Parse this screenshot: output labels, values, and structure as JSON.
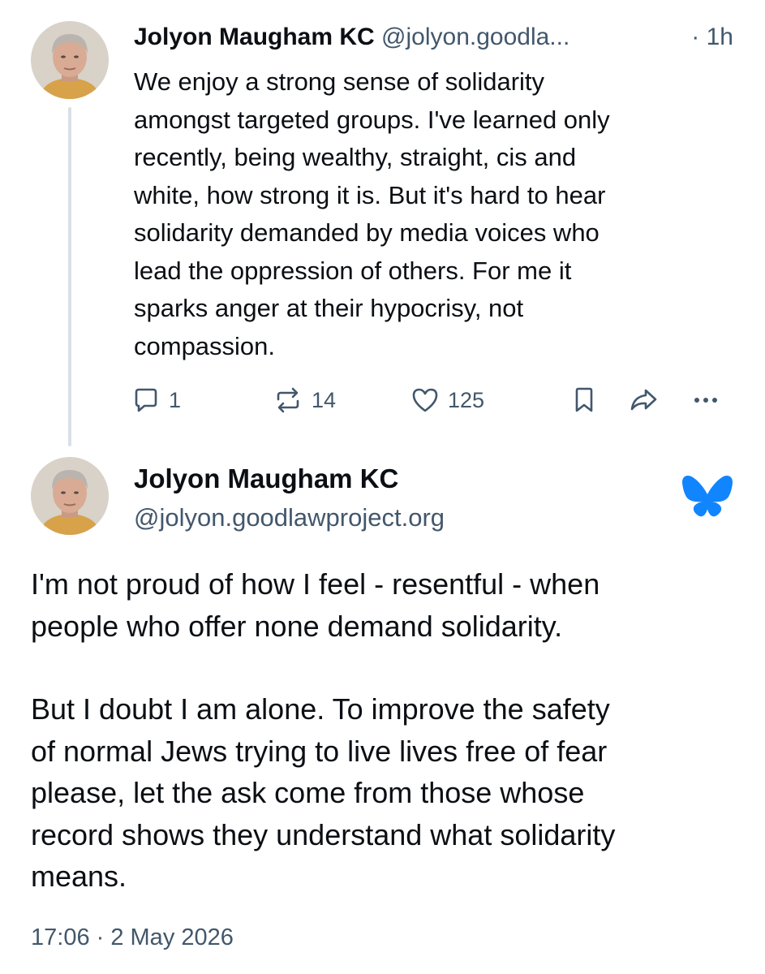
{
  "parent_post": {
    "author_name": "Jolyon Maugham KC",
    "author_handle": "@jolyon.goodla...",
    "time_ago": "· 1h",
    "text_lines": [
      "We enjoy a strong sense of solidarity",
      "amongst targeted groups. I've learned only",
      "recently, being wealthy, straight, cis and",
      "white, how strong it is. But it's hard to hear",
      "solidarity demanded by media voices who",
      "lead the oppression of others. For me it",
      "sparks anger at their hypocrisy, not",
      "compassion."
    ],
    "actions": {
      "reply_count": "1",
      "repost_count": "14",
      "like_count": "125"
    }
  },
  "main_post": {
    "author_name": "Jolyon Maugham KC",
    "author_handle": "@jolyon.goodlawproject.org",
    "paragraphs": [
      {
        "lines": [
          "I'm not proud of how I feel - resentful - when",
          "people who offer none demand solidarity."
        ]
      },
      {
        "lines": [
          "But I doubt I am alone. To improve the safety",
          "of normal Jews trying to live lives free of fear",
          "please, let the ask come from those whose",
          "record shows they understand what solidarity",
          "means."
        ]
      }
    ],
    "timestamp": "17:06 · 2 May 2026"
  },
  "icons": {
    "reply": "speech-bubble-icon",
    "repost": "repost-arrows-icon",
    "like": "heart-outline-icon",
    "bookmark": "bookmark-icon",
    "share": "share-arrow-icon",
    "more": "ellipsis-icon",
    "brand": "bluesky-butterfly-icon"
  },
  "colors": {
    "text_primary": "#0b0f14",
    "text_secondary": "#42576c",
    "thread_line": "#d9e0e6",
    "brand_blue": "#1185fe"
  }
}
